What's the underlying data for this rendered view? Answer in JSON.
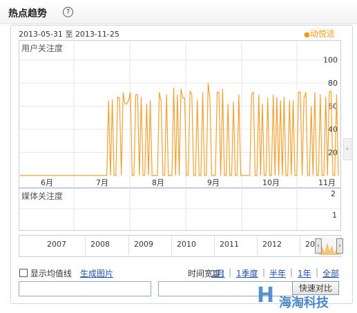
{
  "header": {
    "title": "热点趋势",
    "help_icon": "question-circle-icon"
  },
  "range": {
    "start": "2013-05-31",
    "sep": "至",
    "end": "2013-11-25",
    "brand_dot": "●",
    "brand": "动悦适",
    "brand_color": "#f39c12"
  },
  "user_chart": {
    "title": "用户关注度",
    "y_ticks": [
      "100",
      "80",
      "60",
      "40",
      "20"
    ],
    "x_ticks": [
      "6月",
      "7月",
      "8月",
      "9月",
      "10月",
      "11月"
    ]
  },
  "media_chart": {
    "title": "媒体关注度",
    "y_ticks": [
      "2",
      "1"
    ]
  },
  "overview": {
    "years": [
      "2007",
      "2008",
      "2009",
      "2010",
      "2011",
      "2012",
      "20"
    ]
  },
  "controls": {
    "avg_checkbox_label": "显示均值线",
    "make_image": "生成图片",
    "span_label": "时间宽度：",
    "spans": [
      "1月",
      "1季度",
      "半年",
      "1年",
      "全部"
    ],
    "separator": "|",
    "compare_button": "快速对比"
  },
  "watermark": {
    "text": "海淘科技"
  },
  "chart_data": {
    "type": "line",
    "title": "",
    "xlabel": "",
    "ylabel": "用户关注度",
    "ylim": [
      0,
      110
    ],
    "x_ticks": [
      "6月",
      "7月",
      "8月",
      "9月",
      "10月",
      "11月"
    ],
    "series": [
      {
        "color": "#f0a030",
        "values": [
          0,
          0,
          0,
          0,
          0,
          0,
          0,
          0,
          0,
          0,
          0,
          0,
          0,
          0,
          0,
          0,
          0,
          0,
          0,
          0,
          0,
          0,
          0,
          0,
          0,
          0,
          0,
          0,
          0,
          0,
          0,
          0,
          0,
          0,
          0,
          0,
          0,
          0,
          0,
          0,
          0,
          0,
          0,
          0,
          0,
          0,
          0,
          0,
          0,
          65,
          0,
          66,
          0,
          0,
          68,
          67,
          0,
          72,
          62,
          62,
          65,
          72,
          0,
          0,
          70,
          70,
          0,
          68,
          0,
          0,
          62,
          0,
          65,
          0,
          0,
          0,
          0,
          72,
          64,
          0,
          0,
          70,
          0,
          0,
          0,
          76,
          0,
          70,
          0,
          75,
          67,
          67,
          0,
          0,
          73,
          70,
          0,
          0,
          66,
          0,
          0,
          72,
          0,
          0,
          80,
          66,
          0,
          0,
          0,
          72,
          72,
          0,
          75,
          0,
          0,
          62,
          0,
          0,
          64,
          0,
          0,
          70,
          0,
          0,
          0,
          0,
          0,
          0,
          70,
          72,
          0,
          0,
          70,
          0,
          62,
          0,
          0,
          67,
          0,
          0,
          70,
          0,
          68,
          0,
          65,
          0,
          68,
          0,
          0,
          65,
          0,
          65,
          0,
          0,
          72,
          72,
          0,
          67,
          72,
          0,
          0,
          60,
          0,
          72,
          0,
          0,
          70,
          0,
          0,
          68,
          0,
          72,
          73,
          0,
          0,
          70,
          0
        ]
      }
    ]
  }
}
